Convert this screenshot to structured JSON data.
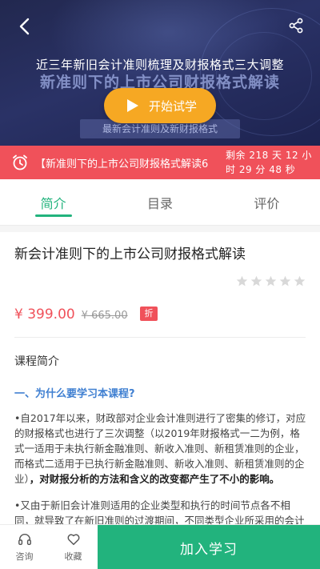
{
  "banner": {
    "top_title": "近三年新旧会计准则梳理及财报格式三大调整",
    "course_title_overlay": "新准则下的上市公司财报格式解读",
    "subtitle": "最新会计准则及新财报格式",
    "play_label": "开始试学"
  },
  "promo": {
    "text": "【新准则下的上市公司财报格式解读6",
    "countdown_line1": "剩余 218 天 12 小",
    "countdown_line2": "时 29 分 48 秒"
  },
  "tabs": [
    {
      "label": "简介",
      "active": true
    },
    {
      "label": "目录",
      "active": false
    },
    {
      "label": "评价",
      "active": false
    }
  ],
  "course": {
    "title": "新会计准则下的上市公司财报格式解读",
    "rating": 0,
    "price": "¥ 399.00",
    "original_price": "¥ 665.00",
    "discount_label": "折"
  },
  "intro": {
    "heading": "课程简介",
    "question": "一、为什么要学习本课程?",
    "para1_normal": "•自2017年以来，财政部对企业会计准则进行了密集的修订，对应的财报格式也进行了三次调整（以2019年财报格式一二为例，格式一适用于未执行新金融准则、新收入准则、新租赁准则的企业，而格式二适用于已执行新金融准则、新收入准则、新租赁准则的企业）",
    "para1_bold": "，对财报分析的方法和含义的改变都产生了不小的影响。",
    "para2": "•又由于新旧会计准则适用的企业类型和执行的时间节点各不相同，就导致了在新旧准则的过渡期间，不同类型企业所采用的会计准则与财报格式会存在差异，对于财报分析有较大的影响。"
  },
  "bottom_bar": {
    "consult_label": "咨询",
    "favorite_label": "收藏",
    "join_label": "加入学习"
  },
  "colors": {
    "accent_green": "#22b37d",
    "promo_red": "#f0515a",
    "play_orange": "#f6a823",
    "link_blue": "#3f7fd1"
  }
}
